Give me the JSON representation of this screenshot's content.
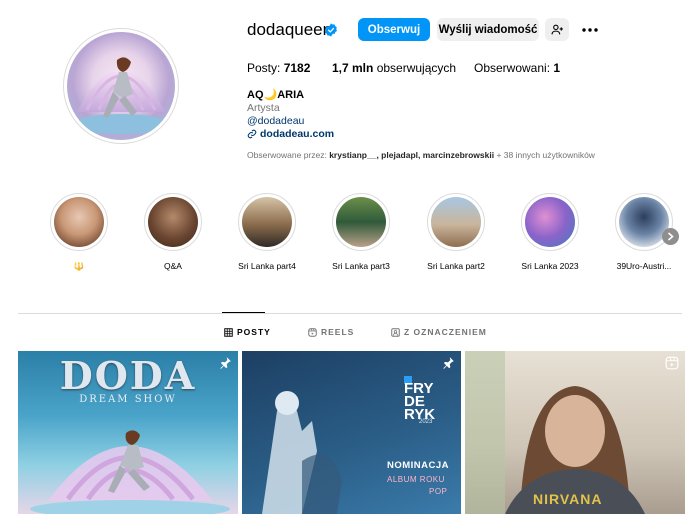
{
  "profile": {
    "username": "dodaqueen",
    "follow_label": "Obserwuj",
    "message_label": "Wyślij wiadomość",
    "stats": {
      "posts_label": "Posty: ",
      "posts_value": "7182",
      "followers_value": "1,7 mln",
      "followers_label": " obserwujących",
      "following_label": "Obserwowani: ",
      "following_value": "1"
    },
    "full_name": "AQ🌙ARIA",
    "category": "Artysta",
    "handle": "@dodadeau",
    "website": "dodadeau.com",
    "followed_by_prefix": "Obserwowane przez: ",
    "followed_by_users": "krystianp__, plejadapl, marcinzebrowskii",
    "followed_by_suffix": " + 38 innych użytkowników"
  },
  "highlights": [
    {
      "label": "🔱"
    },
    {
      "label": "Q&A"
    },
    {
      "label": "Sri Lanka part4"
    },
    {
      "label": "Sri Lanka part3"
    },
    {
      "label": "Sri Lanka part2"
    },
    {
      "label": "Sri Lanka 2023"
    },
    {
      "label": "39Uro-Austri..."
    }
  ],
  "tabs": {
    "posts": "POSTY",
    "reels": "REELS",
    "tagged": "Z OZNACZENIEM"
  },
  "posts": [
    {
      "title": "DODA",
      "subtitle": "DREAM SHOW"
    },
    {
      "logo_line1": "FRY",
      "logo_line2": "DE",
      "logo_line3": "RYK",
      "year": "2023",
      "nomination": "NOMINACJA",
      "category1": "ALBUM ROKU",
      "category2": "POP"
    },
    {
      "shirt_text": "NIRVANA"
    }
  ],
  "colors": {
    "accent": "#0095f6",
    "verified": "#0095f6",
    "link": "#00376b",
    "muted": "#737373"
  }
}
